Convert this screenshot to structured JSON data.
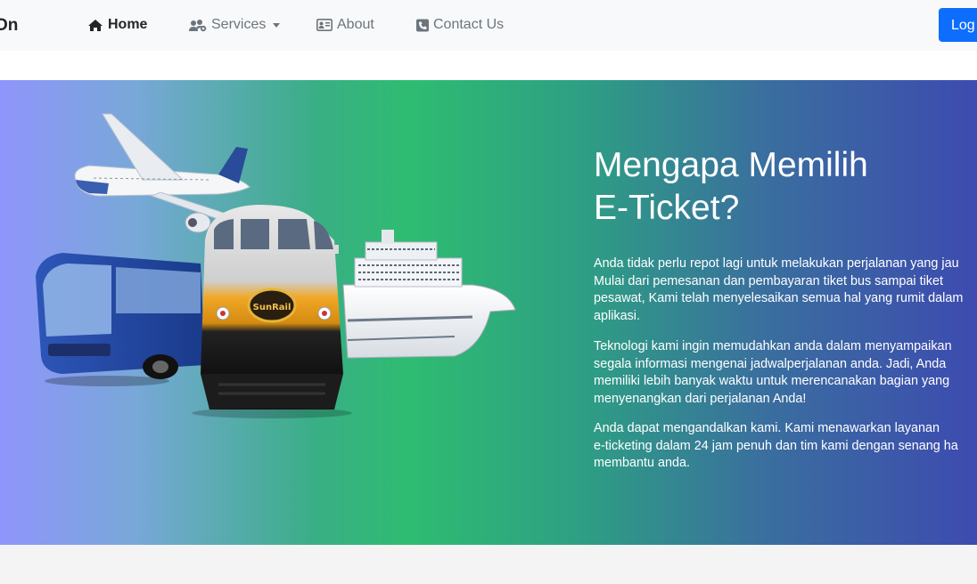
{
  "navbar": {
    "brand": "On",
    "items": [
      {
        "label": "Home",
        "icon": "home-icon",
        "active": true
      },
      {
        "label": "Services",
        "icon": "users-cog-icon",
        "dropdown": true
      },
      {
        "label": "About",
        "icon": "id-card-icon"
      },
      {
        "label": "Contact Us",
        "icon": "phone-square-icon"
      }
    ],
    "login_label": "Log"
  },
  "hero": {
    "title_line1": "Mengapa Memilih",
    "title_line2": "E-Ticket?",
    "paragraphs": [
      [
        "Anda tidak perlu repot lagi untuk melakukan perjalanan yang jau",
        "Mulai dari pemesanan dan pembayaran tiket bus sampai tiket",
        "pesawat, Kami telah menyelesaikan semua hal yang rumit dalam",
        "aplikasi."
      ],
      [
        "Teknologi kami ingin memudahkan anda dalam menyampaikan",
        "segala informasi mengenai jadwalperjalanan anda. Jadi, Anda",
        "memiliki lebih banyak waktu untuk merencanakan bagian yang",
        "menyenangkan dari perjalanan Anda!"
      ],
      [
        "Anda dapat mengandalkan kami. Kami menawarkan layanan",
        "e-ticketing dalam 24 jam penuh dan tim kami dengan senang ha",
        "membantu anda."
      ]
    ],
    "train_logo": "SunRail"
  },
  "colors": {
    "primary": "#0d6efd",
    "navbar_bg": "#f8f9fa",
    "gradient_left": "#8f95fb",
    "gradient_mid": "#2ebc71",
    "gradient_right": "#3d4bb0"
  }
}
